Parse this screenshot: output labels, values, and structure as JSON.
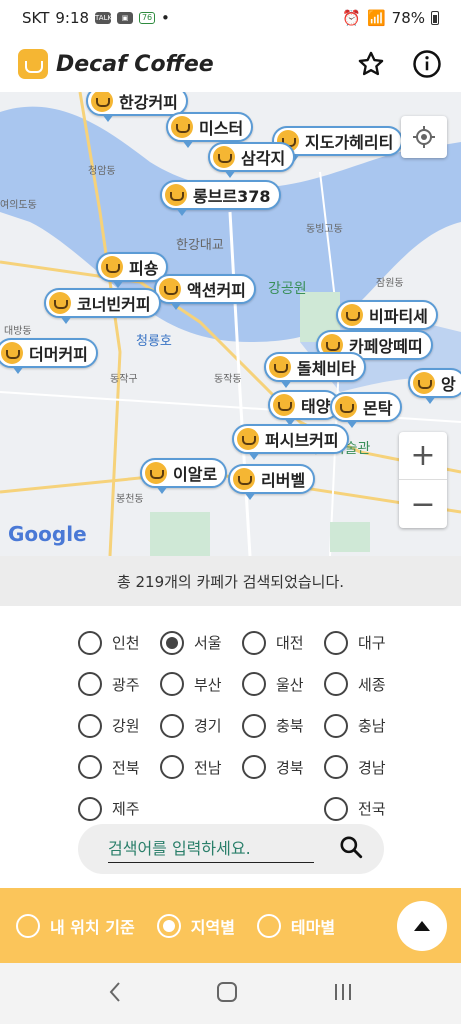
{
  "status_bar": {
    "carrier": "SKT",
    "time": "9:18",
    "battery": "78%"
  },
  "app": {
    "title": "Decaf Coffee"
  },
  "map": {
    "pins": [
      "한강커피",
      "미스터",
      "지도가헤리티",
      "삼각지",
      "롱브르378",
      "피숑",
      "액션커피",
      "코너빈커피",
      "더머커피",
      "비파티세",
      "카페앙떼띠",
      "돌체비타",
      "태양",
      "몬탁",
      "퍼시브커피",
      "이알로",
      "리버벨",
      "앙"
    ],
    "labels": [
      "청암동",
      "여의도동",
      "한강대교",
      "동빙고동",
      "잠원동",
      "대방동",
      "청룡호",
      "동작구",
      "동작동",
      "봉천동",
      "강공원",
      "가람미술관"
    ],
    "google": "Google"
  },
  "result_text": "총 219개의 카페가 검색되었습니다.",
  "regions": [
    [
      {
        "label": "인천",
        "checked": false
      },
      {
        "label": "서울",
        "checked": true
      },
      {
        "label": "대전",
        "checked": false
      },
      {
        "label": "대구",
        "checked": false
      }
    ],
    [
      {
        "label": "광주",
        "checked": false
      },
      {
        "label": "부산",
        "checked": false
      },
      {
        "label": "울산",
        "checked": false
      },
      {
        "label": "세종",
        "checked": false
      }
    ],
    [
      {
        "label": "강원",
        "checked": false
      },
      {
        "label": "경기",
        "checked": false
      },
      {
        "label": "충북",
        "checked": false
      },
      {
        "label": "충남",
        "checked": false
      }
    ],
    [
      {
        "label": "전북",
        "checked": false
      },
      {
        "label": "전남",
        "checked": false
      },
      {
        "label": "경북",
        "checked": false
      },
      {
        "label": "경남",
        "checked": false
      }
    ],
    [
      {
        "label": "제주",
        "checked": false
      },
      {
        "label": "",
        "checked": false
      },
      {
        "label": "",
        "checked": false
      },
      {
        "label": "전국",
        "checked": false
      }
    ]
  ],
  "search": {
    "placeholder": "검색어를 입력하세요."
  },
  "bottom_options": [
    {
      "label": "내 위치 기준",
      "checked": false
    },
    {
      "label": "지역별",
      "checked": true
    },
    {
      "label": "테마별",
      "checked": false
    }
  ],
  "colors": {
    "accent": "#fbc55a",
    "pin_border": "#5b9bd5",
    "river": "#a9c6ef"
  }
}
